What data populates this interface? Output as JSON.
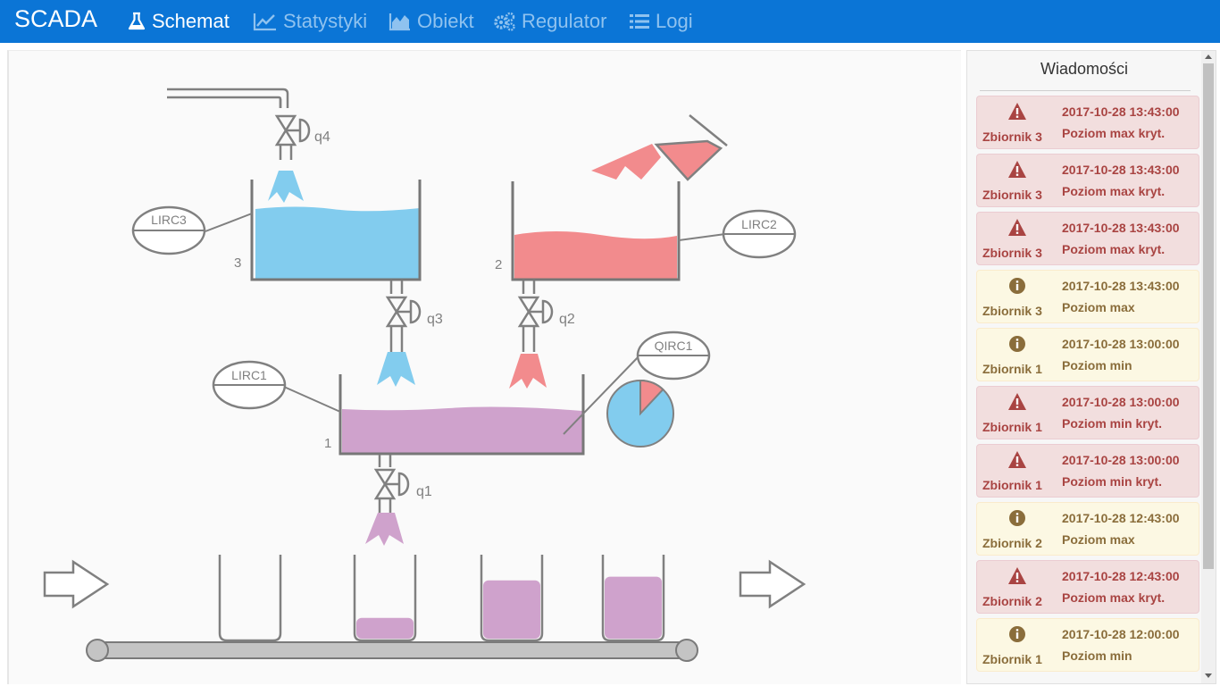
{
  "navbar": {
    "brand": "SCADA",
    "items": [
      {
        "label": "Schemat",
        "icon": "flask-icon",
        "active": true
      },
      {
        "label": "Statystyki",
        "icon": "line-chart-icon",
        "active": false
      },
      {
        "label": "Obiekt",
        "icon": "area-chart-icon",
        "active": false
      },
      {
        "label": "Regulator",
        "icon": "cogs-icon",
        "active": false
      },
      {
        "label": "Logi",
        "icon": "list-icon",
        "active": false
      }
    ]
  },
  "schema": {
    "tanks": [
      {
        "number": "3",
        "controller": "LIRC3",
        "fluid_color": "#82ccee"
      },
      {
        "number": "2",
        "controller": "LIRC2",
        "fluid_color": "#f28b8d"
      },
      {
        "number": "1",
        "controller": "LIRC1",
        "fluid_color": "#cfa2cc"
      }
    ],
    "valves": [
      "q4",
      "q3",
      "q2",
      "q1"
    ],
    "quality_controller": "QIRC1",
    "pie_chart": {
      "red_fraction": 0.12,
      "colors": {
        "red": "#f28b8d",
        "blue": "#82ccee"
      }
    },
    "bottles": [
      0.0,
      0.3,
      0.8,
      0.85
    ]
  },
  "messages": {
    "title": "Wiadomości",
    "items": [
      {
        "level": "danger",
        "icon": "warning-icon",
        "time": "2017-10-28 13:43:00",
        "source": "Zbiornik 3",
        "text": "Poziom max kryt."
      },
      {
        "level": "danger",
        "icon": "warning-icon",
        "time": "2017-10-28 13:43:00",
        "source": "Zbiornik 3",
        "text": "Poziom max kryt."
      },
      {
        "level": "danger",
        "icon": "warning-icon",
        "time": "2017-10-28 13:43:00",
        "source": "Zbiornik 3",
        "text": "Poziom max kryt."
      },
      {
        "level": "warning",
        "icon": "info-icon",
        "time": "2017-10-28 13:43:00",
        "source": "Zbiornik 3",
        "text": "Poziom max"
      },
      {
        "level": "warning",
        "icon": "info-icon",
        "time": "2017-10-28 13:00:00",
        "source": "Zbiornik 1",
        "text": "Poziom min"
      },
      {
        "level": "danger",
        "icon": "warning-icon",
        "time": "2017-10-28 13:00:00",
        "source": "Zbiornik 1",
        "text": "Poziom min kryt."
      },
      {
        "level": "danger",
        "icon": "warning-icon",
        "time": "2017-10-28 13:00:00",
        "source": "Zbiornik 1",
        "text": "Poziom min kryt."
      },
      {
        "level": "warning",
        "icon": "info-icon",
        "time": "2017-10-28 12:43:00",
        "source": "Zbiornik 2",
        "text": "Poziom max"
      },
      {
        "level": "danger",
        "icon": "warning-icon",
        "time": "2017-10-28 12:43:00",
        "source": "Zbiornik 2",
        "text": "Poziom max kryt."
      },
      {
        "level": "warning",
        "icon": "info-icon",
        "time": "2017-10-28 12:00:00",
        "source": "Zbiornik 1",
        "text": "Poziom min"
      }
    ]
  }
}
